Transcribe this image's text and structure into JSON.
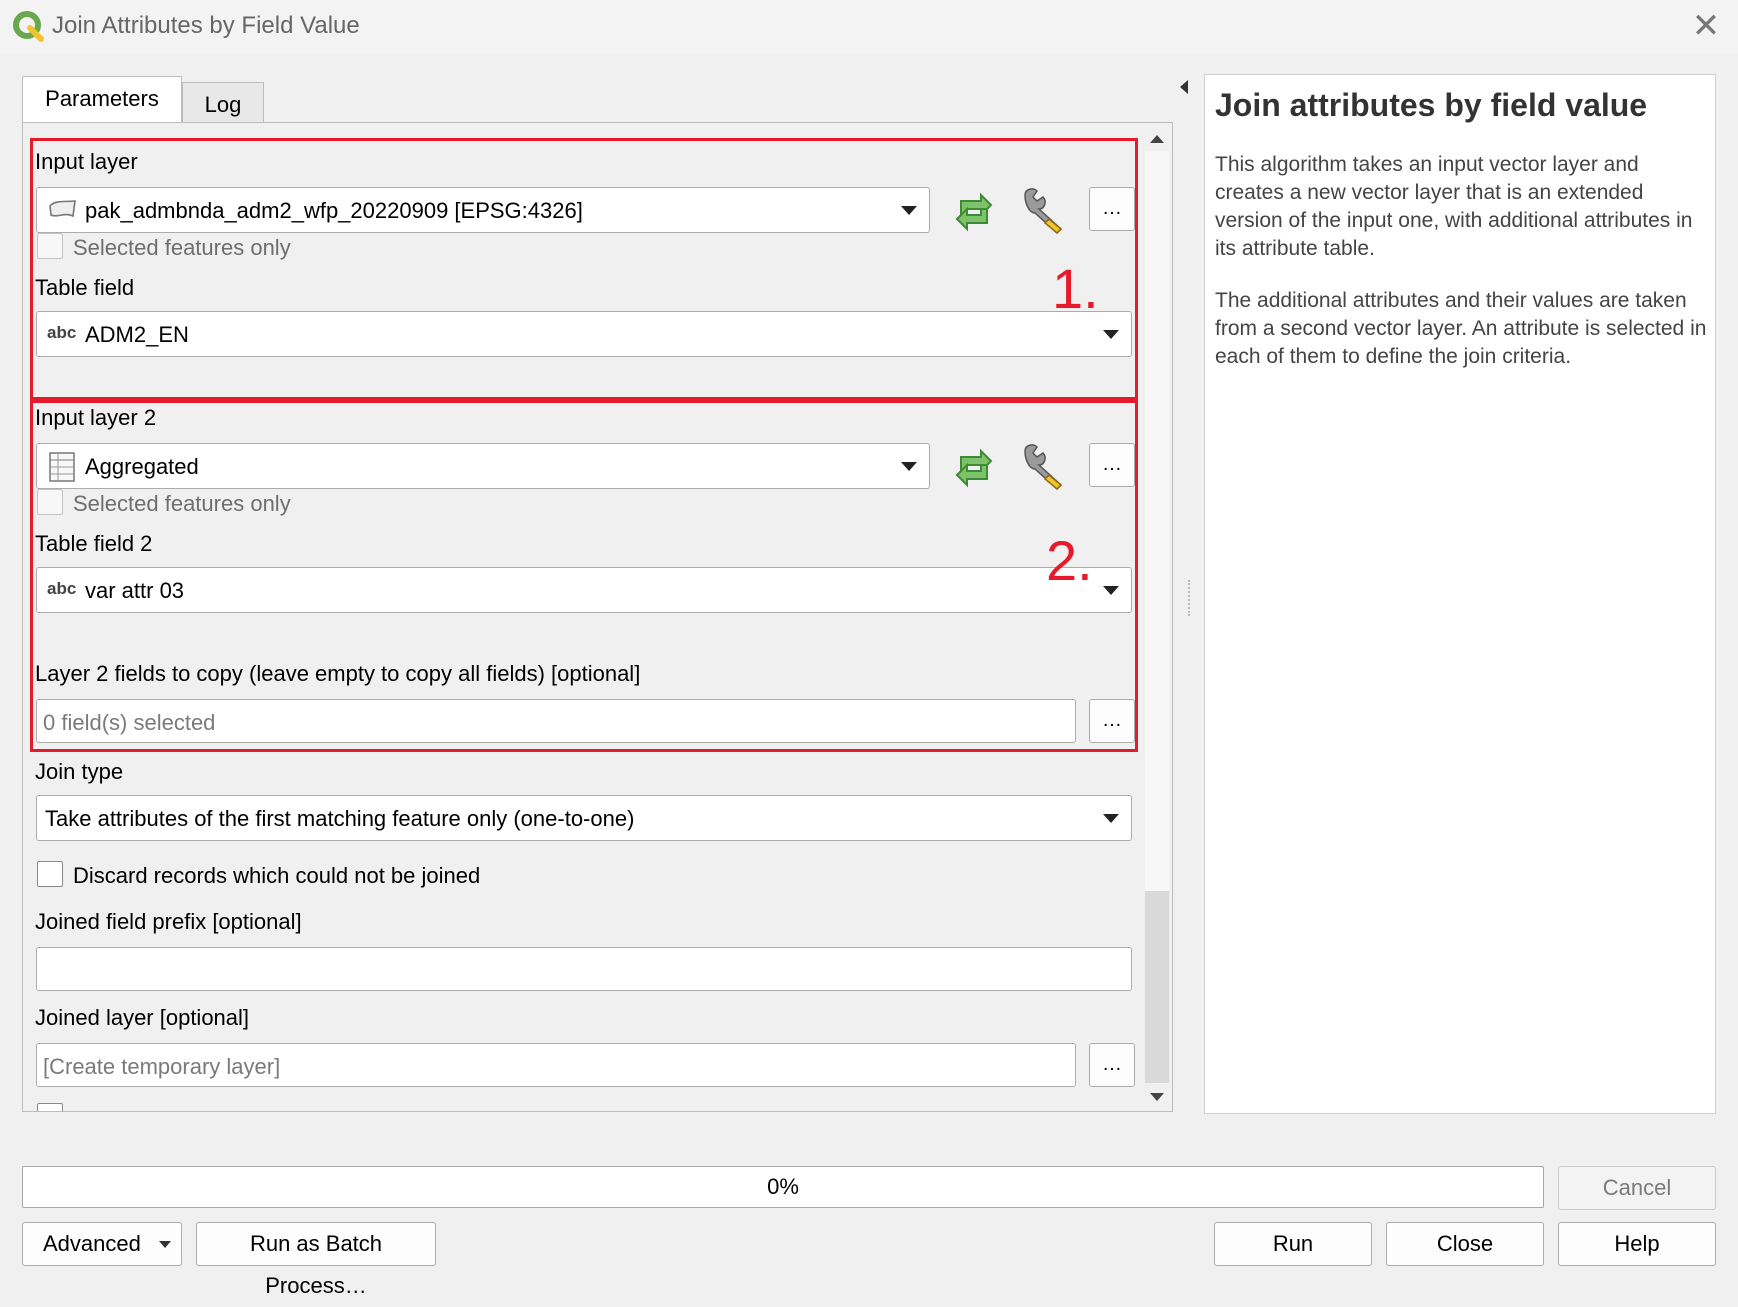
{
  "window": {
    "title": "Join Attributes by Field Value",
    "close_glyph": "✕"
  },
  "tabs": [
    {
      "label": "Parameters"
    },
    {
      "label": "Log"
    }
  ],
  "params": {
    "input_layer": {
      "label": "Input layer",
      "value": "pak_admbnda_adm2_wfp_20220909 [EPSG:4326]",
      "selected_only": "Selected features only"
    },
    "table_field": {
      "label": "Table field",
      "type_badge": "abc",
      "value": "ADM2_EN"
    },
    "input_layer_2": {
      "label": "Input layer 2",
      "value": "Aggregated",
      "selected_only": "Selected features only"
    },
    "table_field_2": {
      "label": "Table field 2",
      "type_badge": "abc",
      "value": "var attr 03"
    },
    "fields_to_copy": {
      "label": "Layer 2 fields to copy (leave empty to copy all fields) [optional]",
      "value": "0 field(s) selected"
    },
    "join_type": {
      "label": "Join type",
      "value": "Take attributes of the first matching feature only (one-to-one)"
    },
    "discard": {
      "label": "Discard records which could not be joined"
    },
    "prefix": {
      "label": "Joined field prefix [optional]",
      "value": ""
    },
    "joined_layer": {
      "label": "Joined layer [optional]",
      "placeholder": "[Create temporary layer]"
    },
    "dots": "…"
  },
  "annotations": {
    "box1": "1.",
    "box2": "2."
  },
  "help": {
    "title": "Join attributes by field value",
    "para1": "This algorithm takes an input vector layer and creates a new vector layer that is an extended version of the input one, with additional attributes in its attribute table.",
    "para2": "The additional attributes and their values are taken from a second vector layer. An attribute is selected in each of them to define the join criteria."
  },
  "footer": {
    "progress_text": "0%",
    "progress_value": 0,
    "cancel": "Cancel",
    "advanced": "Advanced",
    "batch": "Run as Batch Process…",
    "run": "Run",
    "close": "Close",
    "help": "Help"
  },
  "colors": {
    "annotation_red": "#e51a2a",
    "qgis_green": "#6aa84f",
    "refresh_green": "#5fae4c"
  }
}
